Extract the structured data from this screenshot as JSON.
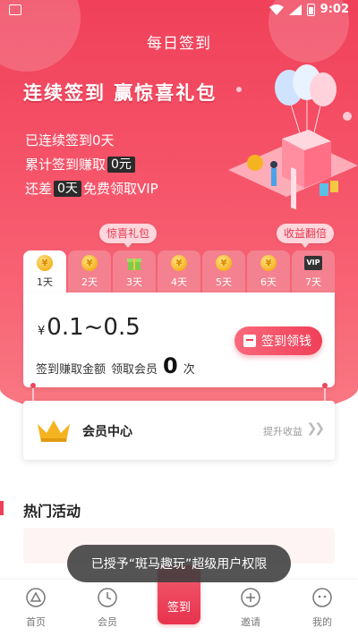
{
  "status_bar": {
    "time": "9:02"
  },
  "header": {
    "title": "每日签到"
  },
  "hero": {
    "slogan": "连续签到 赢惊喜礼包",
    "streak_prefix": "已连续签到",
    "streak_days": "0",
    "streak_suffix": "天",
    "earned_prefix": "累计签到赚取",
    "earned_value": "0元",
    "remaining_prefix": "还差",
    "remaining_value": "0天",
    "remaining_suffix": "免费领取VIP"
  },
  "badges": {
    "surprise": "惊喜礼包",
    "double": "收益翻倍"
  },
  "days": [
    {
      "label": "1天",
      "icon": "coin-icon",
      "active": true
    },
    {
      "label": "2天",
      "icon": "coin-icon",
      "active": false
    },
    {
      "label": "3天",
      "icon": "gift-icon",
      "active": false
    },
    {
      "label": "4天",
      "icon": "coin-icon",
      "active": false
    },
    {
      "label": "5天",
      "icon": "coin-icon",
      "active": false
    },
    {
      "label": "6天",
      "icon": "coin-icon",
      "active": false
    },
    {
      "label": "7天",
      "icon": "vip-icon",
      "icon_text": "VIP",
      "active": false
    }
  ],
  "card": {
    "currency": "¥",
    "amount": "0.1~0.5",
    "earn_label": "签到赚取金额",
    "member_label": "领取会员",
    "member_value": "0",
    "member_unit": "次",
    "button": "签到领钱"
  },
  "member_center": {
    "title": "会员中心",
    "link": "提升收益"
  },
  "hot": {
    "title": "热门活动"
  },
  "toast": {
    "text": "已授予“斑马趣玩”超级用户权限"
  },
  "nav": {
    "items": [
      {
        "label": "首页",
        "icon": "home-icon"
      },
      {
        "label": "会员",
        "icon": "clock-icon"
      },
      {
        "label": "签到",
        "icon": "sign-icon"
      },
      {
        "label": "邀请",
        "icon": "plus-circle-icon"
      },
      {
        "label": "我的",
        "icon": "face-icon"
      }
    ]
  },
  "colors": {
    "primary": "#ef3f58",
    "hero": "#f0405a",
    "badge_bg": "#ffd6dc"
  }
}
